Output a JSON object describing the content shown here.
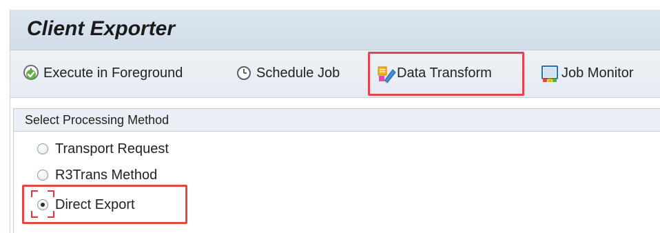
{
  "window": {
    "title": "Client Exporter"
  },
  "toolbar": {
    "execute_label": "Execute in Foreground",
    "schedule_label": "Schedule Job",
    "transform_label": "Data Transform",
    "monitor_label": "Job Monitor"
  },
  "icons": {
    "execute": "execute-clock-check-icon",
    "schedule": "clock-icon",
    "transform": "pencil-data-icon",
    "monitor": "monitor-icon"
  },
  "processing": {
    "group_title": "Select Processing Method",
    "options": [
      {
        "label": "Transport Request",
        "selected": false
      },
      {
        "label": "R3Trans Method",
        "selected": false
      },
      {
        "label": "Direct Export",
        "selected": true
      }
    ]
  },
  "colors": {
    "highlight": "#e04848",
    "title_bar": "#d6e0ea",
    "toolbar": "#e8eef3"
  }
}
